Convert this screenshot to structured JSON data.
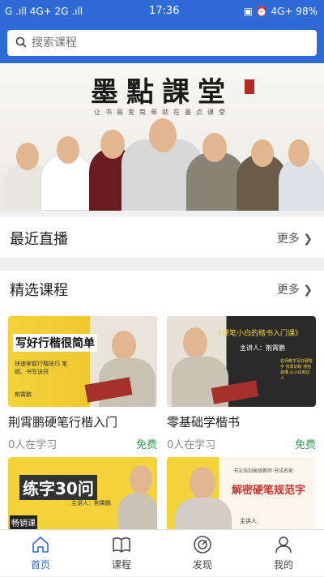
{
  "status_bar": {
    "left": "G .ıll 4G+ 2G .ıll",
    "time": "17:36",
    "right": "▣ ⏰ 4G+ 98%"
  },
  "search": {
    "placeholder": "搜索课程"
  },
  "banner": {
    "title": "墨點課堂",
    "subtitle": "让书画变简单就在墨点课堂"
  },
  "recent_live": {
    "title": "最近直播",
    "more": "更多"
  },
  "featured": {
    "title": "精选课程",
    "more": "更多",
    "courses": [
      {
        "name": "荆霄鹏硬笔行楷入门",
        "learners": "0人在学习",
        "price": "免费",
        "thumb_text": "写好行楷很简单",
        "thumb_sub": "快速掌握行楷技巧 笔顺、书写诀窍",
        "thumb_author": "荆霄鹏"
      },
      {
        "name": "零基础学楷书",
        "learners": "0人在学习",
        "price": "免费",
        "thumb_text": "《硬笔小白的楷书入门课》",
        "thumb_sub": "主讲人：荆霄鹏",
        "thumb_author": "名师教学写好硬笔字 情景训练 通俗易懂 从小白到达人"
      },
      {
        "name": "",
        "learners": "",
        "price": "",
        "thumb_text": "练字30问",
        "thumb_sub": "主讲人：荆霄鹏",
        "thumb_author": "畅销课"
      },
      {
        "name": "",
        "learners": "",
        "price": "",
        "thumb_text": "解密硬笔规范字",
        "thumb_sub": "书法培训高级教师 书法名家",
        "thumb_author": "主讲人"
      }
    ]
  },
  "tabbar": {
    "items": [
      {
        "label": "首页"
      },
      {
        "label": "课程"
      },
      {
        "label": "发现"
      },
      {
        "label": "我的"
      }
    ]
  },
  "colors": {
    "brand": "#2f6bd6",
    "free": "#2e9e57"
  }
}
